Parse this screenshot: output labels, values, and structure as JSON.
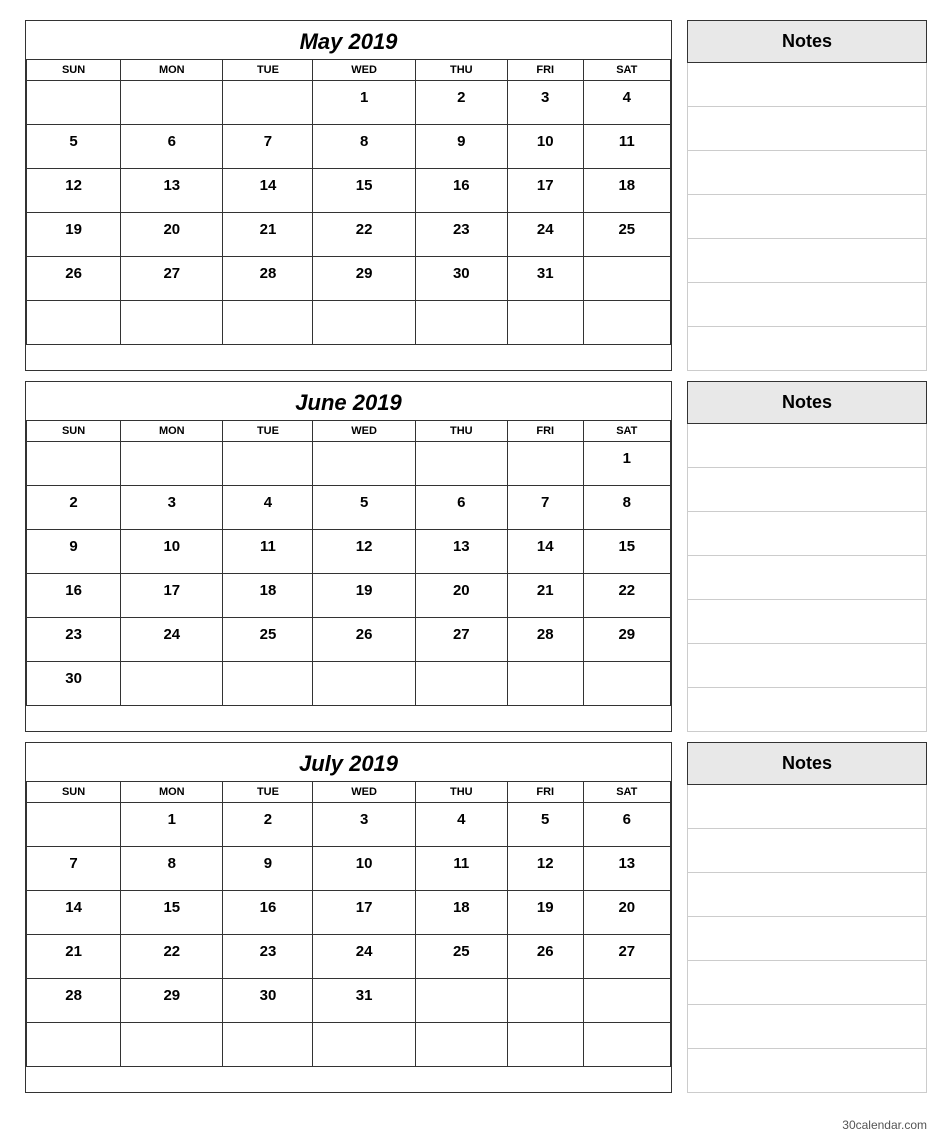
{
  "months": [
    {
      "id": "may",
      "title": "May 2019",
      "days_of_week": [
        "SUN",
        "MON",
        "TUE",
        "WED",
        "THU",
        "FRI",
        "SAT"
      ],
      "weeks": [
        [
          "",
          "",
          "",
          "1",
          "2",
          "3",
          "4"
        ],
        [
          "5",
          "6",
          "7",
          "8",
          "9",
          "10",
          "11"
        ],
        [
          "12",
          "13",
          "14",
          "15",
          "16",
          "17",
          "18"
        ],
        [
          "19",
          "20",
          "21",
          "22",
          "23",
          "24",
          "25"
        ],
        [
          "26",
          "27",
          "28",
          "29",
          "30",
          "31",
          ""
        ],
        [
          "",
          "",
          "",
          "",
          "",
          "",
          ""
        ]
      ],
      "notes_label": "Notes",
      "notes_line_count": 7
    },
    {
      "id": "june",
      "title": "June 2019",
      "days_of_week": [
        "SUN",
        "MON",
        "TUE",
        "WED",
        "THU",
        "FRI",
        "SAT"
      ],
      "weeks": [
        [
          "",
          "",
          "",
          "",
          "",
          "",
          "1"
        ],
        [
          "2",
          "3",
          "4",
          "5",
          "6",
          "7",
          "8"
        ],
        [
          "9",
          "10",
          "11",
          "12",
          "13",
          "14",
          "15"
        ],
        [
          "16",
          "17",
          "18",
          "19",
          "20",
          "21",
          "22"
        ],
        [
          "23",
          "24",
          "25",
          "26",
          "27",
          "28",
          "29"
        ],
        [
          "30",
          "",
          "",
          "",
          "",
          "",
          ""
        ]
      ],
      "notes_label": "Notes",
      "notes_line_count": 7
    },
    {
      "id": "july",
      "title": "July 2019",
      "days_of_week": [
        "SUN",
        "MON",
        "TUE",
        "WED",
        "THU",
        "FRI",
        "SAT"
      ],
      "weeks": [
        [
          "",
          "1",
          "2",
          "3",
          "4",
          "5",
          "6"
        ],
        [
          "7",
          "8",
          "9",
          "10",
          "11",
          "12",
          "13"
        ],
        [
          "14",
          "15",
          "16",
          "17",
          "18",
          "19",
          "20"
        ],
        [
          "21",
          "22",
          "23",
          "24",
          "25",
          "26",
          "27"
        ],
        [
          "28",
          "29",
          "30",
          "31",
          "",
          "",
          ""
        ],
        [
          "",
          "",
          "",
          "",
          "",
          "",
          ""
        ]
      ],
      "notes_label": "Notes",
      "notes_line_count": 7
    }
  ],
  "footer": {
    "text": "30calendar.com"
  }
}
